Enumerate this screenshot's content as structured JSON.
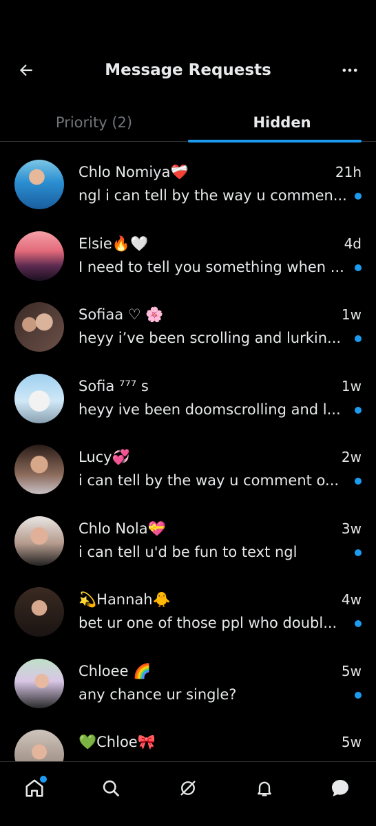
{
  "header": {
    "title": "Message Requests",
    "back_icon": "arrow-left-icon",
    "more_icon": "more-horizontal-icon"
  },
  "tabs": [
    {
      "label": "Priority (2)"
    },
    {
      "label": "Hidden"
    }
  ],
  "colors": {
    "accent": "#1d9bf0",
    "background": "#000000",
    "text": "#e7e9ea",
    "muted": "#71767b"
  },
  "messages": [
    {
      "name": "Chlo Nomiya❤️‍🩹",
      "time": "21h",
      "preview": "ngl i can tell by the way u commen..."
    },
    {
      "name": "Elsie🔥🤍",
      "time": "4d",
      "preview": "I need to tell you something when ..."
    },
    {
      "name": "Sofiaa ♡ 🌸",
      "time": "1w",
      "preview": "heyy i’ve been scrolling and lurkin..."
    },
    {
      "name": "Sofia ⁷⁷⁷ s",
      "time": "1w",
      "preview": "heyy ive been doomscrolling and l..."
    },
    {
      "name": "Lucy💞",
      "time": "2w",
      "preview": "i can tell by the way u comment o..."
    },
    {
      "name": "Chlo Nola💝",
      "time": "3w",
      "preview": "i can tell u'd be fun to text ngl"
    },
    {
      "name": "💫Hannah🐥",
      "time": "4w",
      "preview": "bet ur one of those ppl who doubl..."
    },
    {
      "name": "Chloee 🌈",
      "time": "5w",
      "preview": "any chance ur single?"
    },
    {
      "name": "💚Chloe🎀",
      "time": "5w",
      "preview": ""
    }
  ],
  "nav": [
    {
      "icon": "home-icon"
    },
    {
      "icon": "search-icon"
    },
    {
      "icon": "grok-icon"
    },
    {
      "icon": "notifications-icon"
    },
    {
      "icon": "messages-icon"
    }
  ]
}
